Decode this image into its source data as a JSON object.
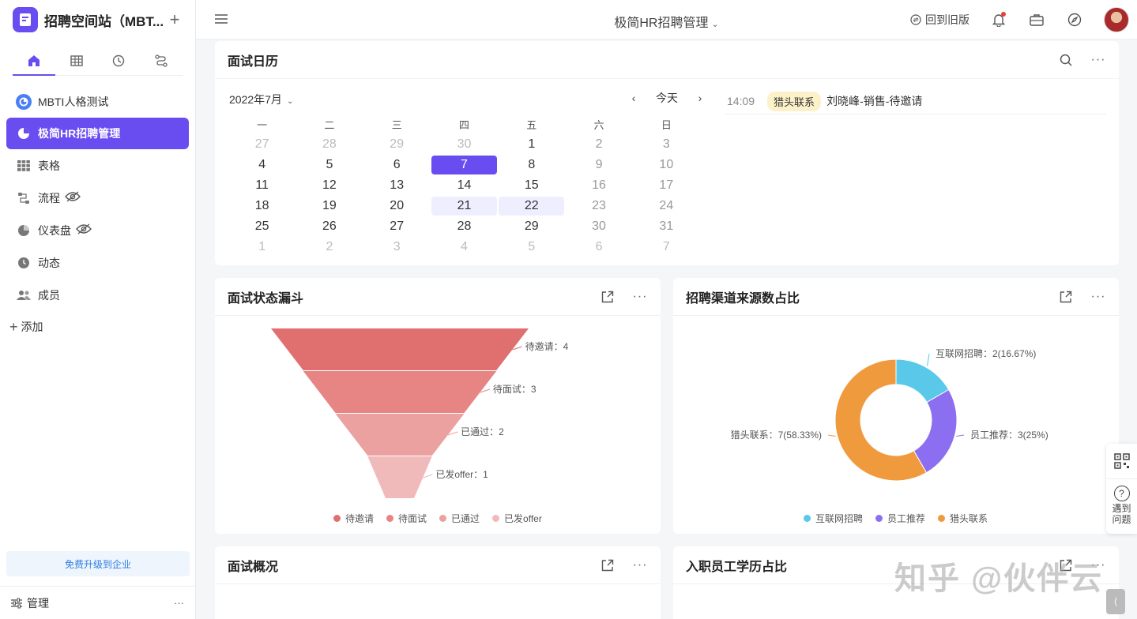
{
  "sidebar": {
    "workspace_title": "招聘空间站（MBT...",
    "items": [
      {
        "label": "MBTI人格测试"
      },
      {
        "label": "极简HR招聘管理"
      },
      {
        "label": "表格"
      },
      {
        "label": "流程"
      },
      {
        "label": "仪表盘"
      },
      {
        "label": "动态"
      },
      {
        "label": "成员"
      }
    ],
    "add_label": "添加",
    "upgrade_label": "免费升级到企业",
    "manage_label": "管理",
    "more": "···"
  },
  "topbar": {
    "title": "极简HR招聘管理",
    "back_old": "回到旧版"
  },
  "calendar_card": {
    "title": "面试日历",
    "month_label": "2022年7月",
    "today_label": "今天",
    "weekdays": [
      "一",
      "二",
      "三",
      "四",
      "五",
      "六",
      "日"
    ],
    "weeks": [
      [
        "27",
        "28",
        "29",
        "30",
        "1",
        "2",
        "3"
      ],
      [
        "4",
        "5",
        "6",
        "7",
        "8",
        "9",
        "10"
      ],
      [
        "11",
        "12",
        "13",
        "14",
        "15",
        "16",
        "17"
      ],
      [
        "18",
        "19",
        "20",
        "21",
        "22",
        "23",
        "24"
      ],
      [
        "25",
        "26",
        "27",
        "28",
        "29",
        "30",
        "31"
      ],
      [
        "1",
        "2",
        "3",
        "4",
        "5",
        "6",
        "7"
      ]
    ],
    "selected_day": "7",
    "event": {
      "time": "14:09",
      "tag": "猎头联系",
      "desc": "刘晓峰-销售-待邀请"
    }
  },
  "funnel_card": {
    "title": "面试状态漏斗",
    "chart_data": {
      "type": "funnel",
      "categories": [
        "待邀请",
        "待面试",
        "已通过",
        "已发offer"
      ],
      "values": [
        4,
        3,
        2,
        1
      ],
      "labels": [
        "待邀请：4",
        "待面试：3",
        "已通过：2",
        "已发offer：1"
      ],
      "colors": [
        "#e07070",
        "#e78585",
        "#eca1a1",
        "#f1baba"
      ],
      "legend": "bottom"
    }
  },
  "channel_card": {
    "title": "招聘渠道来源数占比",
    "chart_data": {
      "type": "pie",
      "categories": [
        "互联网招聘",
        "员工推荐",
        "猎头联系"
      ],
      "values": [
        2,
        3,
        7
      ],
      "labels": [
        "互联网招聘：2(16.67%)",
        "员工推荐：3(25%)",
        "猎头联系：7(58.33%)"
      ],
      "colors": [
        "#5ac8e8",
        "#8b6ff0",
        "#f09a3e"
      ],
      "legend": "bottom"
    }
  },
  "overview_card": {
    "title": "面试概况"
  },
  "education_card": {
    "title": "入职员工学历占比"
  },
  "float": {
    "help_label_1": "遇到",
    "help_label_2": "问题"
  },
  "watermark": "知乎 @伙伴云",
  "corner": "⟨"
}
